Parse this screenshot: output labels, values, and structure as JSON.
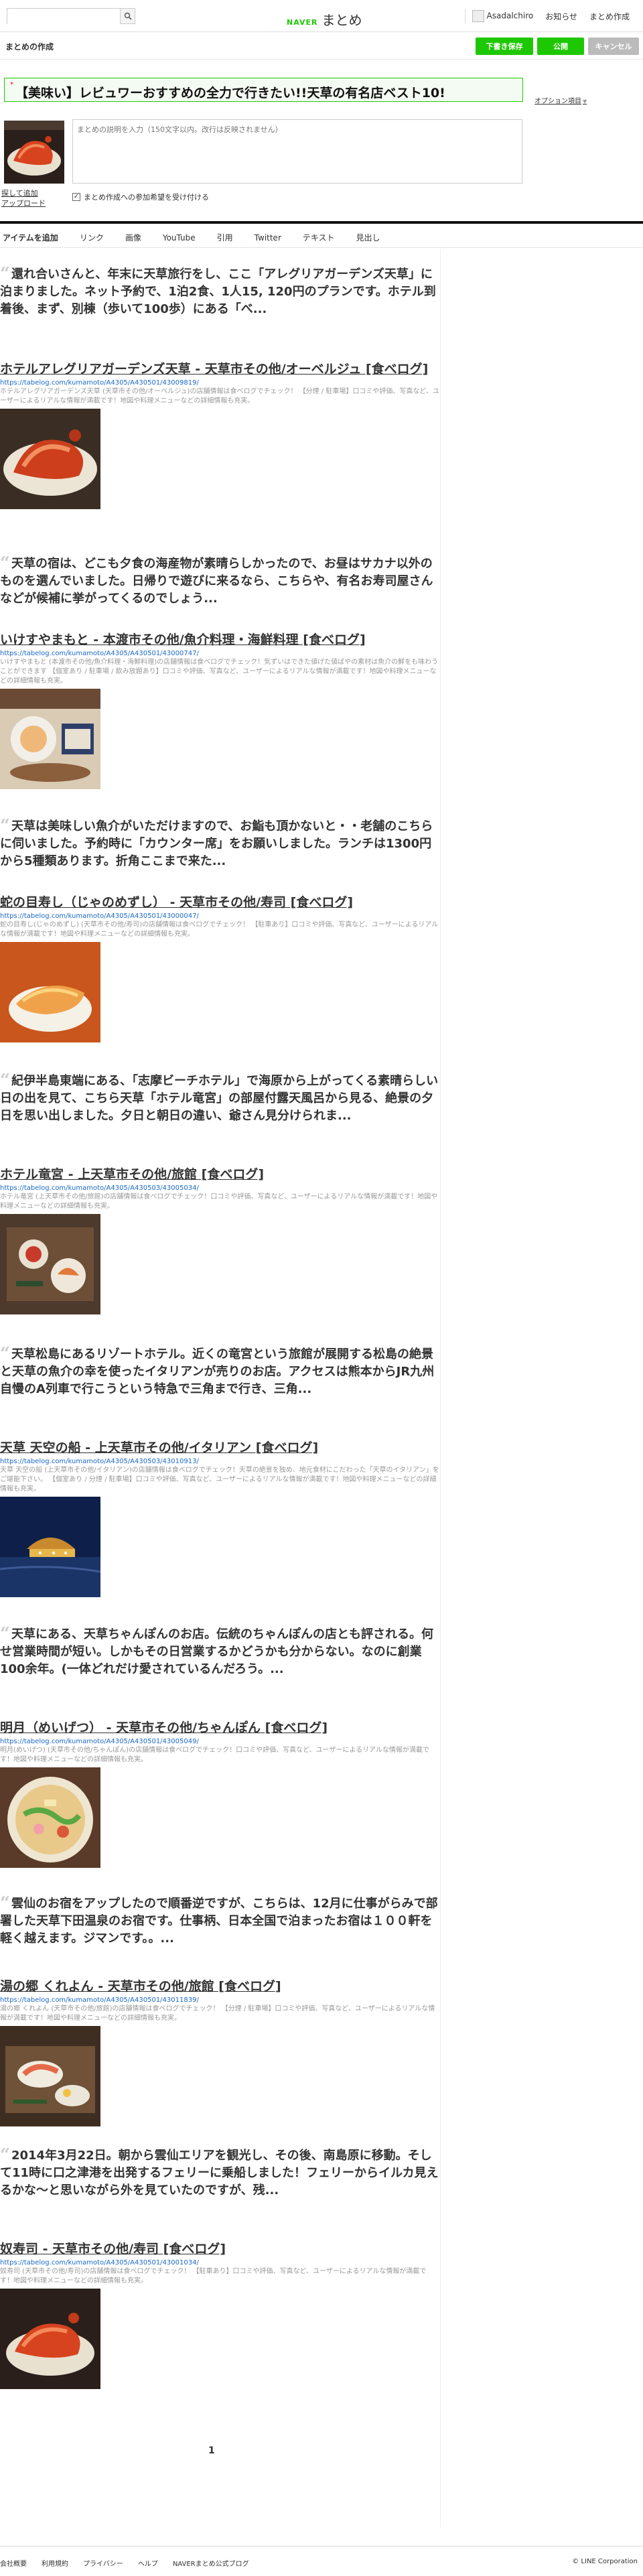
{
  "header": {
    "search_placeholder": "",
    "logo_naver": "NAVER",
    "logo_matome": "まとめ",
    "user_name": "Asadalchiro",
    "notice": "お知らせ",
    "create": "まとめ作成"
  },
  "editbar": {
    "title": "まとめの作成",
    "draft": "下書き保存",
    "publish": "公開",
    "cancel": "キャンセル"
  },
  "matome": {
    "title": "【美味い】レビュワーおすすめの全力で行きたい!!天草の有名店ベスト10!",
    "option": "オプション項目",
    "description_placeholder": "まとめの説明を入力（150文字以内。改行は反映されません）",
    "thumb_links": [
      "探して追加",
      "アップロード"
    ],
    "participation": "まとめ作成への参加希望を受け付ける"
  },
  "tabs": [
    "アイテムを追加",
    "リンク",
    "画像",
    "YouTube",
    "引用",
    "Twitter",
    "テキスト",
    "見出し"
  ],
  "items": [
    {
      "quote": "還れ合いさんと、年末に天草旅行をし、ここ「アレグリアガーデンズ天草」に泊まりました。ネット予約で、1泊2食、1人15, 120円のプランです。ホテル到着後、まず、別棟（歩いて100歩）にある「べ...",
      "title": "ホテルアレグリアガーデンズ天草 - 天草市その他/オーベルジュ [食べログ]",
      "url": "https://tabelog.com/kumamoto/A4305/A430501/43009819/",
      "desc": "ホテルアレグリアガーデンズ天草 (天草市その他/オーベルジュ)の店舗情報は食べログでチェック！ 【分煙 / 駐車場】口コミや評価、写真など、ユーザーによるリアルな情報が満載です！地図や料理メニューなどの詳細情報も充実。"
    },
    {
      "quote": "天草の宿は、どこも夕食の海産物が素晴らしかったので、お昼はサカナ以外のものを選んでいました。日帰りで遊びに来るなら、こちらや、有名お寿司屋さんなどが候補に挙がってくるのでしょう...",
      "title": "いけすやまもと - 本渡市その他/魚介料理・海鮮料理 [食べログ]",
      "url": "https://tabelog.com/kumamoto/A4305/A430501/43000747/",
      "desc": "いけすやまもと (本渡市その他/魚介料理・海鮮料理)の店舗情報は食べログでチェック！気ずいはできた値げた値ばやの素材は魚介の鮮をも味わうことができます 【個室あり / 駐車場 / 飲み放題あり】口コミや評価、写真など、ユーザーによるリアルな情報が満載です！地図や料理メニューなどの詳細情報も充実。"
    },
    {
      "quote": "天草は美味しい魚介がいただけますので、お鮨も頂かないと・・老舗のこちらに伺いました。予約時に「カウンター席」をお願いしました。ランチは1300円から5種類あります。折角ここまで来た...",
      "title": "蛇の目寿し（じゃのめずし） - 天草市その他/寿司 [食べログ]",
      "url": "https://tabelog.com/kumamoto/A4305/A430501/43000047/",
      "desc": "蛇の目寿し(じゃのめずし) (天草市その他/寿司)の店舗情報は食べログでチェック！ 【駐車あり】口コミや評価、写真など、ユーザーによるリアルな情報が満載です！地図や料理メニューなどの詳細情報も充実。"
    },
    {
      "quote": "紀伊半島東端にある、「志摩ビーチホテル」で海原から上がってくる素晴らしい日の出を見て、こちら天草「ホテル竜宮」の部屋付露天風呂から見る、絶景の夕日を思い出しました。夕日と朝日の違い、爺さん見分けられま...",
      "title": "ホテル竜宮 - 上天草市その他/旅館 [食べログ]",
      "url": "https://tabelog.com/kumamoto/A4305/A430503/43005034/",
      "desc": "ホテル竜宮 (上天草市その他/旅館)の店舗情報は食べログでチェック！口コミや評価、写真など、ユーザーによるリアルな情報が満載です！地図や料理メニューなどの詳細情報も充実。"
    },
    {
      "quote": "天草松島にあるリゾートホテル。近くの竜宮という旅館が展開する松島の絶景と天草の魚介の幸を使ったイタリアンが売りのお店。アクセスは熊本からJR九州自慢のA列車で行こうという特急で三角まで行き、三角...",
      "title": "天草 天空の船 - 上天草市その他/イタリアン [食べログ]",
      "url": "https://tabelog.com/kumamoto/A4305/A430503/43010913/",
      "desc": "天草 天空の船 (上天草市その他/イタリアン)の店舗情報は食べログでチェック！天草の絶景を独め、地元食材にこだわった「天草のイタリアン」をご堪能下さい。 【個室あり / 分煙 / 駐車場】口コミや評価、写真など、ユーザーによるリアルな情報が満載です！地図や料理メニューなどの詳細情報も充実。"
    },
    {
      "quote": "天草にある、天草ちゃんぽんのお店。伝統のちゃんぽんの店とも評される。何せ営業時間が短い。しかもその日営業するかどうかも分からない。なのに創業100余年。(一体どれだけ愛されているんだろう。...",
      "title": "明月（めいげつ） - 天草市その他/ちゃんぽん [食べログ]",
      "url": "https://tabelog.com/kumamoto/A4305/A430501/43005049/",
      "desc": "明月(めいげつ) (天草市その他/ちゃんぽん)の店舗情報は食べログでチェック！口コミや評価、写真など、ユーザーによるリアルな情報が満載です！地図や料理メニューなどの詳細情報も充実。"
    },
    {
      "quote": "雲仙のお宿をアップしたので順番逆ですが、こちらは、12月に仕事がらみで部署した天草下田温泉のお宿です。仕事柄、日本全国で泊まったお宿は１００軒を軽く越えます。ジマンです。。...",
      "title": "湯の郷 くれよん - 天草市その他/旅館 [食べログ]",
      "url": "https://tabelog.com/kumamoto/A4305/A430501/43011839/",
      "desc": "湯の郷 くれよん (天草市その他/旅館)の店舗情報は食べログでチェック！ 【分煙 / 駐車場】口コミや評価、写真など、ユーザーによるリアルな情報が満載です！地図や料理メニューなどの詳細情報も充実。"
    },
    {
      "quote": "2014年3月22日。朝から雲仙エリアを観光し、その後、南島原に移動。そして11時に口之津港を出発するフェリーに乗船しました！フェリーからイルカ見えるかな～と思いながら外を見ていたのですが、残...",
      "title": "奴寿司 - 天草市その他/寿司 [食べログ]",
      "url": "https://tabelog.com/kumamoto/A4305/A430501/43001034/",
      "desc": "奴寿司 (天草市その他/寿司)の店舗情報は食べログでチェック！ 【駐車あり】口コミや評価、写真など、ユーザーによるリアルな情報が満載です！地図や料理メニューなどの詳細情報も充実。"
    }
  ],
  "pager": "1",
  "footer": {
    "links": [
      "会社概要",
      "利用規約",
      "プライバシー",
      "ヘルプ",
      "NAVERまとめ公式ブログ"
    ],
    "copyright": "© LINE Corporation"
  }
}
